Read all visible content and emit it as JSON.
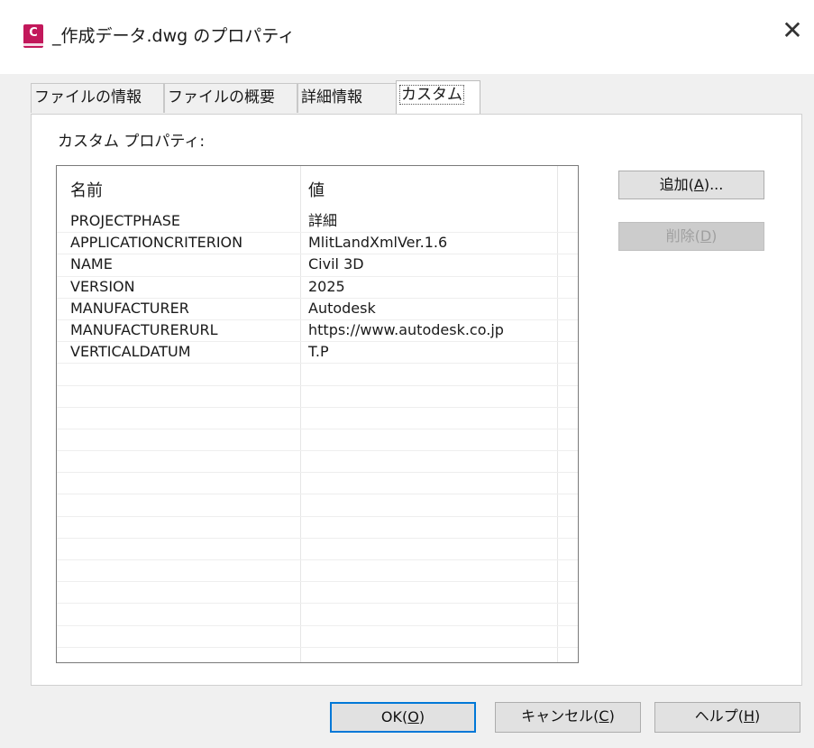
{
  "window": {
    "title": "_作成データ.dwg のプロパティ",
    "app_icon_letter": "C",
    "close_glyph": "✕"
  },
  "tabs": [
    {
      "label": "ファイルの情報",
      "active": false
    },
    {
      "label": "ファイルの概要",
      "active": false
    },
    {
      "label": "詳細情報",
      "active": false
    },
    {
      "label": "カスタム",
      "active": true
    }
  ],
  "panel": {
    "label": "カスタム プロパティ:"
  },
  "listview": {
    "columns": [
      "名前",
      "値"
    ],
    "rows": [
      {
        "name": "PROJECTPHASE",
        "value": "詳細"
      },
      {
        "name": "APPLICATIONCRITERION",
        "value": "MlitLandXmlVer.1.6"
      },
      {
        "name": "NAME",
        "value": "Civil 3D"
      },
      {
        "name": "VERSION",
        "value": "2025"
      },
      {
        "name": "MANUFACTURER",
        "value": "Autodesk"
      },
      {
        "name": "MANUFACTURERURL",
        "value": "https://www.autodesk.co.jp"
      },
      {
        "name": "VERTICALDATUM",
        "value": "T.P"
      }
    ]
  },
  "side_buttons": {
    "add": {
      "text": "追加(",
      "key": "A",
      "suffix": ")..."
    },
    "delete": {
      "text": "削除(",
      "key": "D",
      "suffix": ")",
      "disabled": true
    }
  },
  "footer_buttons": {
    "ok": {
      "text": "OK(",
      "key": "O",
      "suffix": ")"
    },
    "cancel": {
      "text": "キャンセル(",
      "key": "C",
      "suffix": ")"
    },
    "help": {
      "text": "ヘルプ(",
      "key": "H",
      "suffix": ")"
    }
  },
  "colors": {
    "accent": "#0078d7",
    "app_icon": "#c2185b",
    "dialog_bg": "#f0f0f0"
  }
}
